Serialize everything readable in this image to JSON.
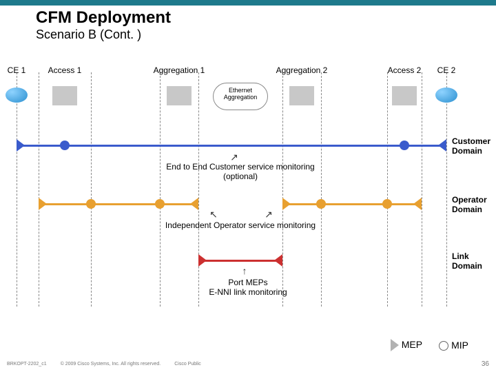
{
  "header": {
    "title": "CFM Deployment",
    "subtitle": "Scenario B (Cont. )"
  },
  "columns": {
    "ce1": "CE 1",
    "access1": "Access 1",
    "agg1": "Aggregation 1",
    "agg2": "Aggregation 2",
    "access2": "Access 2",
    "ce2": "CE 2"
  },
  "cloud": {
    "line1": "Ethernet",
    "line2": "Aggregation"
  },
  "domains": {
    "customer": {
      "label": "Customer\nDomain",
      "caption": "End to End Customer service monitoring\n(optional)"
    },
    "operator": {
      "label": "Operator\nDomain",
      "caption": "Independent Operator service monitoring"
    },
    "link": {
      "label": "Link\nDomain",
      "caption": "Port MEPs\nE-NNI link monitoring"
    }
  },
  "legend": {
    "mep": "MEP",
    "mip": "MIP"
  },
  "footer": {
    "code": "BRKOPT-2202_c1",
    "copyright": "© 2009 Cisco Systems, Inc. All rights reserved.",
    "classification": "Cisco Public",
    "page": "36"
  },
  "positions": {
    "ce1": 24,
    "a1l": 56,
    "a1r": 132,
    "g1l": 232,
    "g1r": 288,
    "g2l": 410,
    "g2r": 466,
    "a2l": 562,
    "a2r": 612,
    "ce2": 648
  }
}
